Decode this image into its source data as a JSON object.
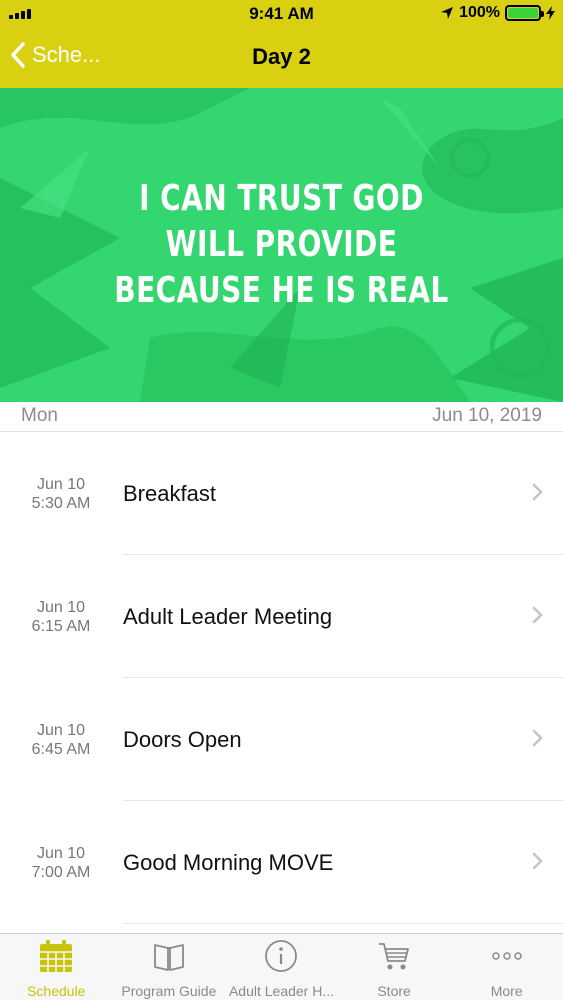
{
  "status_bar": {
    "time": "9:41 AM",
    "battery": "100%"
  },
  "nav": {
    "back_label": "Sche...",
    "title": "Day 2"
  },
  "banner": {
    "lines": [
      "I CAN TRUST GOD",
      "WILL PROVIDE",
      "BECAUSE HE IS REAL"
    ]
  },
  "day_header": {
    "weekday": "Mon",
    "date": "Jun 10, 2019"
  },
  "events": [
    {
      "date": "Jun 10",
      "time": "5:30 AM",
      "title": "Breakfast"
    },
    {
      "date": "Jun 10",
      "time": "6:15 AM",
      "title": "Adult Leader Meeting"
    },
    {
      "date": "Jun 10",
      "time": "6:45 AM",
      "title": "Doors Open"
    },
    {
      "date": "Jun 10",
      "time": "7:00 AM",
      "title": "Good Morning MOVE"
    }
  ],
  "tabs": [
    {
      "label": "Schedule",
      "icon": "calendar-icon",
      "active": true
    },
    {
      "label": "Program Guide",
      "icon": "book-icon",
      "active": false
    },
    {
      "label": "Adult Leader H...",
      "icon": "info-icon",
      "active": false
    },
    {
      "label": "Store",
      "icon": "cart-icon",
      "active": false
    },
    {
      "label": "More",
      "icon": "more-icon",
      "active": false
    }
  ],
  "colors": {
    "nav_bar": "#d8d011",
    "banner": "#2fd36d",
    "active_tab": "#c8c30c"
  }
}
